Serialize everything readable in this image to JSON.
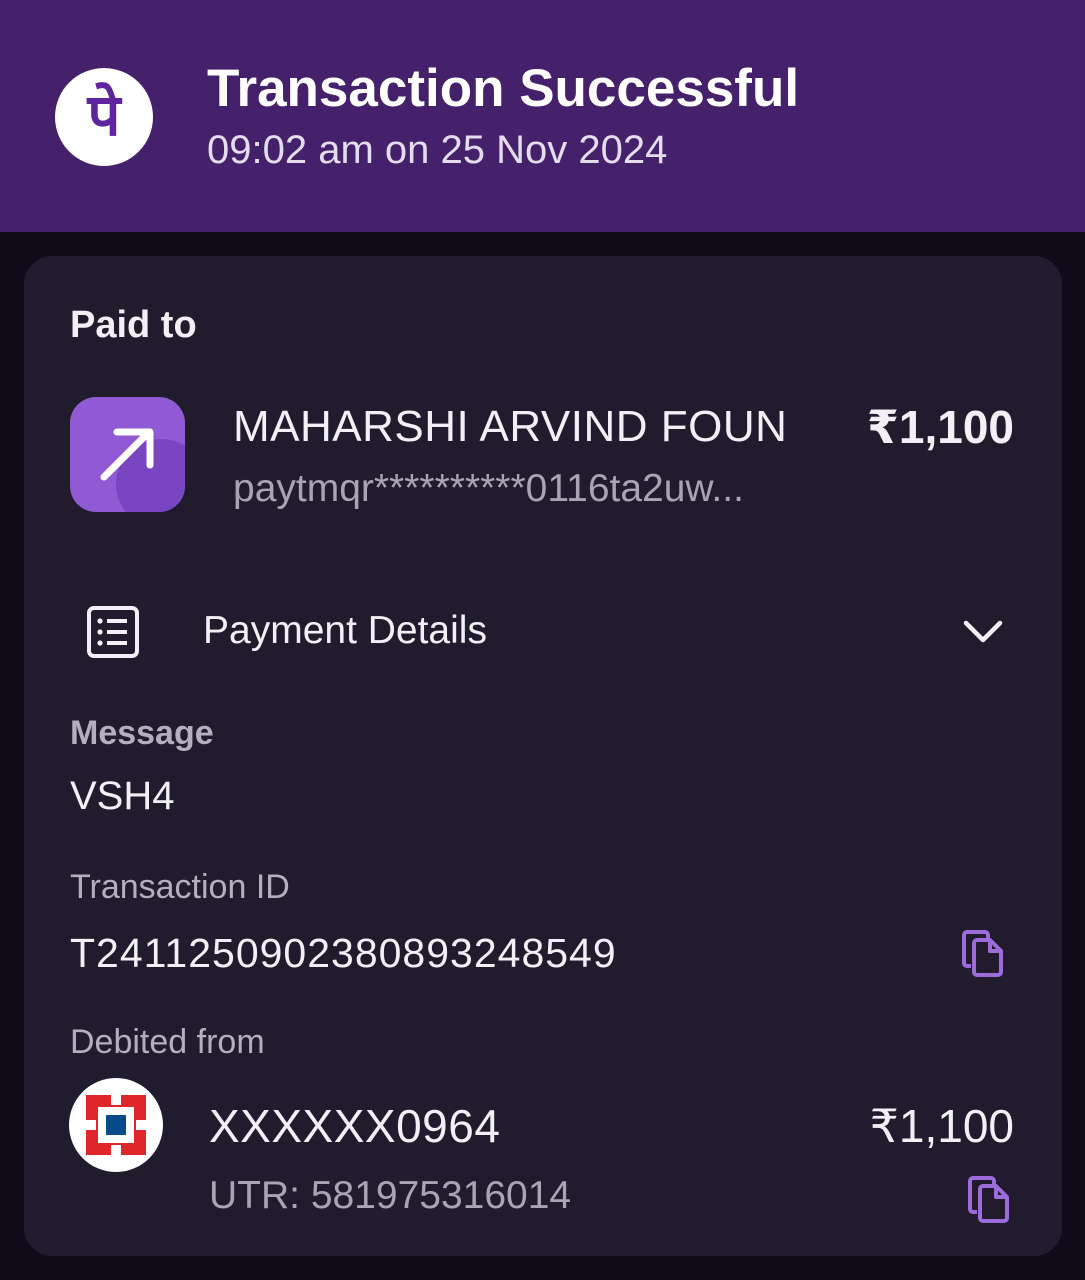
{
  "header": {
    "logo_glyph": "पे",
    "title": "Transaction Successful",
    "subtitle": "09:02 am on 25 Nov 2024"
  },
  "paid_to": {
    "label": "Paid to",
    "name": "MAHARSHI ARVIND FOUN",
    "upi_id": "paytmqr**********0116ta2uw...",
    "amount": "₹1,100",
    "icon": "arrow-up-right-icon"
  },
  "payment_details": {
    "label": "Payment Details",
    "icon": "receipt-list-icon",
    "toggle_icon": "chevron-down-icon",
    "message_label": "Message",
    "message_value": "VSH4",
    "transaction_id_label": "Transaction ID",
    "transaction_id_value": "T2411250902380893248549",
    "copy_icon": "copy-icon"
  },
  "debited_from": {
    "label": "Debited from",
    "account": "XXXXXX0964",
    "utr": "UTR: 581975316014",
    "amount": "₹1,100",
    "bank_icon": "hdfc-bank-logo"
  },
  "colors": {
    "header_bg": "#45206b",
    "brand_purple": "#5f259f",
    "card_bg": "#211c2d",
    "page_bg": "#0f0b19",
    "accent": "#9d6cdb"
  }
}
